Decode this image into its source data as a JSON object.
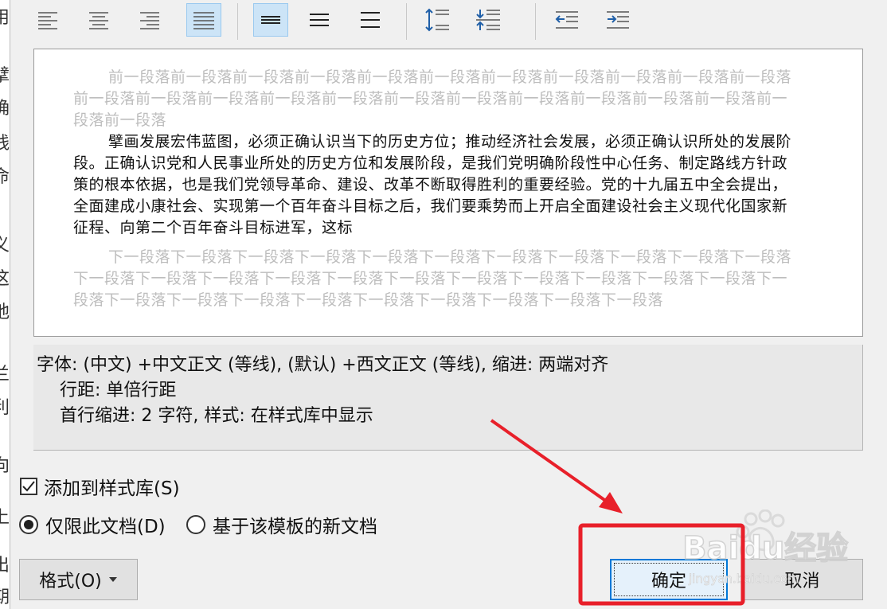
{
  "background_doc": {
    "chars": [
      "用",
      "擘",
      "确",
      "践",
      "命",
      "、",
      "义",
      "这",
      "地",
      "、",
      "兰",
      "利",
      "向",
      "上",
      "出",
      "期"
    ]
  },
  "toolbar": {
    "buttons": [
      {
        "name": "align-left-icon",
        "active": false
      },
      {
        "name": "align-center-icon",
        "active": false
      },
      {
        "name": "align-right-icon",
        "active": false
      },
      {
        "name": "align-justify-icon",
        "active": true
      },
      {
        "name": "line-spacing-single-icon",
        "active": true
      },
      {
        "name": "line-spacing-1-5-icon",
        "active": false
      },
      {
        "name": "line-spacing-double-icon",
        "active": false
      },
      {
        "name": "increase-paragraph-spacing-icon",
        "active": false
      },
      {
        "name": "decrease-paragraph-spacing-icon",
        "active": false
      },
      {
        "name": "decrease-indent-icon",
        "active": false
      },
      {
        "name": "increase-indent-icon",
        "active": false
      }
    ]
  },
  "preview": {
    "previous_paragraph": "前一段落前一段落前一段落前一段落前一段落前一段落前一段落前一段落前一段落前一段落前一段落前一段落前一段落前一段落前一段落前一段落前一段落前一段落前一段落前一段落前一段落前一段落前一段落前一段落",
    "sample_paragraph": "擘画发展宏伟蓝图，必须正确认识当下的历史方位；推动经济社会发展，必须正确认识所处的发展阶段。正确认识党和人民事业所处的历史方位和发展阶段，是我们党明确阶段性中心任务、制定路线方针政策的根本依据，也是我们党领导革命、建设、改革不断取得胜利的重要经验。党的十九届五中全会提出，全面建成小康社会、实现第一个百年奋斗目标之后，我们要乘势而上开启全面建设社会主义现代化国家新征程、向第二个百年奋斗目标进军，这标",
    "next_paragraph": "下一段落下一段落下一段落下一段落下一段落下一段落下一段落下一段落下一段落下一段落下一段落下一段落下一段落下一段落下一段落下一段落下一段落下一段落下一段落下一段落下一段落下一段落下一段落下一段落下一段落下一段落下一段落下一段落下一段落下一段落下一段落下一段落"
  },
  "description": {
    "line1": "字体: (中文) +中文正文 (等线), (默认) +西文正文 (等线), 缩进: 两端对齐",
    "line2": "行距: 单倍行距",
    "line3": "首行缩进:  2 字符, 样式: 在样式库中显示"
  },
  "options": {
    "add_to_gallery": {
      "label": "添加到样式库(S)",
      "checked": true
    },
    "only_this_document": {
      "label": "仅限此文档(D)",
      "selected": true
    },
    "new_documents_template": {
      "label": "基于该模板的新文档",
      "selected": false
    }
  },
  "buttons": {
    "format": "格式(O)",
    "ok": "确定",
    "cancel": "取消"
  },
  "watermark": {
    "text": "Baidu经验",
    "url": "jingyan.baidu.com"
  },
  "colors": {
    "annotation_red": "#e8202a",
    "active_button_bg": "#cce4f7",
    "ok_border": "#0078d7"
  }
}
